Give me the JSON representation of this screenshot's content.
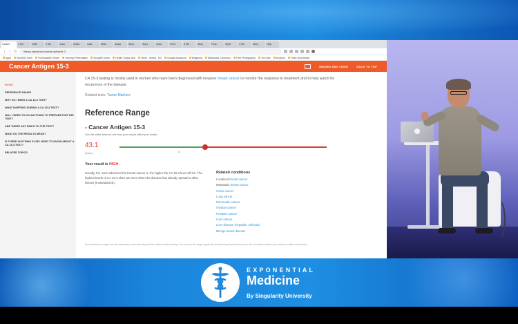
{
  "browser": {
    "tabs": [
      {
        "label": "Cancer",
        "active": true
      },
      {
        "label": "1 Ste"
      },
      {
        "label": "Glide"
      },
      {
        "label": "2 Ste"
      },
      {
        "label": "Canc"
      },
      {
        "label": "Gusto"
      },
      {
        "label": "Gast"
      },
      {
        "label": "Meta"
      },
      {
        "label": "Anato"
      },
      {
        "label": "Story"
      },
      {
        "label": "Story"
      },
      {
        "label": "Canc"
      },
      {
        "label": "Prem"
      },
      {
        "label": "8 Ste"
      },
      {
        "label": "Story"
      },
      {
        "label": "Poss"
      },
      {
        "label": "Spirit"
      },
      {
        "label": "4 Ste"
      },
      {
        "label": "Story"
      },
      {
        "label": "Help"
      }
    ],
    "url": "library.storyshell.com/storyline/lit-3",
    "bookmarks": [
      "Apps",
      "StoryMD Hash",
      "TheVisualMD Heath",
      "Fanning Presentation",
      "StoryMD Demo",
      "Health Topics Med",
      "Home - Media - NC",
      "Google Advanced",
      "Wikipedia",
      "Wikimedia Commons",
      "Free Photography",
      "YouTube",
      "Dropbox",
      "Other Bookmarks"
    ]
  },
  "header": {
    "title": "Cancer Antigen 15-3",
    "images_label": "IMAGES AND VIDEO",
    "back_label": "BACK TO TOP"
  },
  "sidebar": {
    "items": [
      "INTRO",
      "REFERENCE RANGE",
      "WHY DO I NEED A CA 15-3 TEST?",
      "WHAT HAPPENS DURING A CA 15-3 TEST?",
      "WILL I NEED TO DO ANYTHING TO PREPARE FOR THE TEST?",
      "ARE THERE ANY RISKS TO THE TEST?",
      "WHAT DO THE RESULTS MEAN?",
      "IS THERE ANYTHING ELSE I NEED TO KNOW ABOUT A CA 15-3 TEST?",
      "RELATED TOPICS"
    ]
  },
  "content": {
    "intro_pre": "CA 15-3 testing is mostly used in women who have been diagnosed with invasive ",
    "intro_link": "breast cancer",
    "intro_post": " to monitor the response to treatment and to help watch for recurrence of the disease.",
    "related_tests_label": "Related tests: ",
    "related_tests_link": "Tumor Markers",
    "ref_heading": "Reference Range",
    "sub_heading": "- Cancer Antigen 15-3",
    "slider_hint": "Use the slider below to see how your results affect your health.",
    "value": "43.1",
    "unit": "(U/mL)",
    "tick": "31",
    "result_pre": "Your result is ",
    "result_level": "HIGH.",
    "usual_text": "Usually, the more advanced the breast cancer is, the higher the CA 15-3 level will be. The highest levels of CA 15-3 often are seen when the disease has already spread to other tissues (metastasized).",
    "related_heading": "Related conditions",
    "conditions": [
      {
        "prefix": "Localized ",
        "link": "breast cancer"
      },
      {
        "prefix": "Metastatic ",
        "link": "breast cancer"
      },
      {
        "prefix": "",
        "link": "Colon cancer"
      },
      {
        "prefix": "",
        "link": "Lung cancer"
      },
      {
        "prefix": "",
        "link": "Pancreatic cancer"
      },
      {
        "prefix": "",
        "link": "Ovarian cancer"
      },
      {
        "prefix": "",
        "link": "Prostate cancer"
      },
      {
        "prefix": "",
        "link": "Liver cancer"
      },
      {
        "prefix": "",
        "link": "Liver disease (hepatitis, cirrhosis)"
      },
      {
        "prefix": "",
        "link": "Benign breast disease"
      }
    ],
    "footnote": "Normal reference ranges can vary depending on the laboratory and the method used for testing. You must use the range supplied by the laboratory that performed your test to evaluate whether your results are within normal limits."
  },
  "brand": {
    "top": "EXPONENTIAL",
    "main": "Medicine",
    "by": "By Singularity University"
  },
  "colors": {
    "accent": "#f05a28",
    "high": "#e03a2a",
    "link": "#2a8ed6",
    "normal_track": "#4aa35a",
    "high_track": "#d9383a"
  }
}
